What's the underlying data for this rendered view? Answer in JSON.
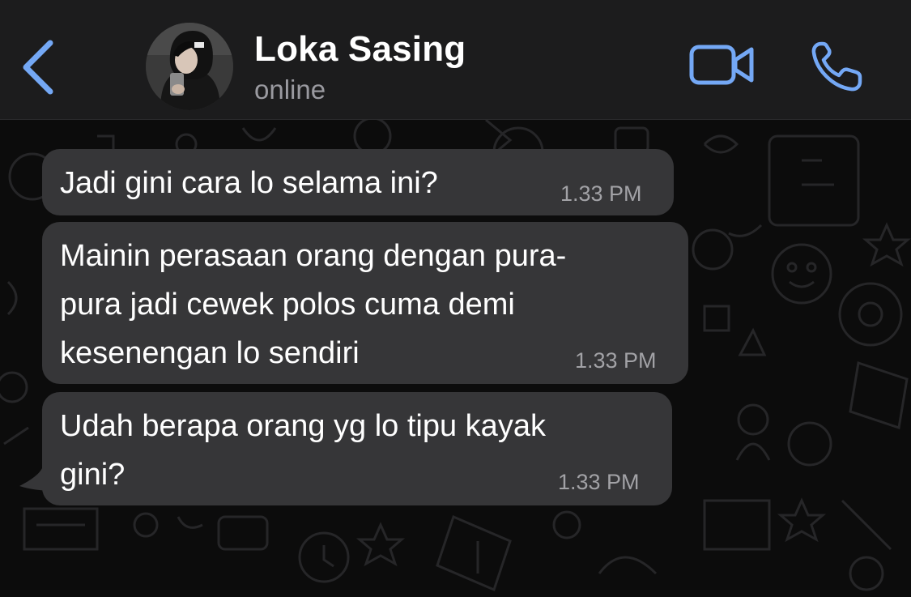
{
  "header": {
    "back_icon": "chevron-left-icon",
    "contact_name": "Loka Sasing",
    "status": "online",
    "video_icon": "video-camera-icon",
    "call_icon": "phone-icon"
  },
  "colors": {
    "accent": "#74a8f5",
    "bubble": "#363638",
    "header_bg": "#1c1c1d",
    "background": "#0b0b0b"
  },
  "messages": [
    {
      "lines": [
        "Jadi gini cara lo selama ini?"
      ],
      "time": "1.33 PM"
    },
    {
      "lines": [
        "Mainin perasaan orang dengan pura-",
        "pura jadi cewek polos cuma demi",
        "kesenengan lo sendiri"
      ],
      "time": "1.33 PM"
    },
    {
      "lines": [
        "Udah berapa orang yg lo tipu kayak",
        "gini?"
      ],
      "time": "1.33 PM"
    }
  ]
}
